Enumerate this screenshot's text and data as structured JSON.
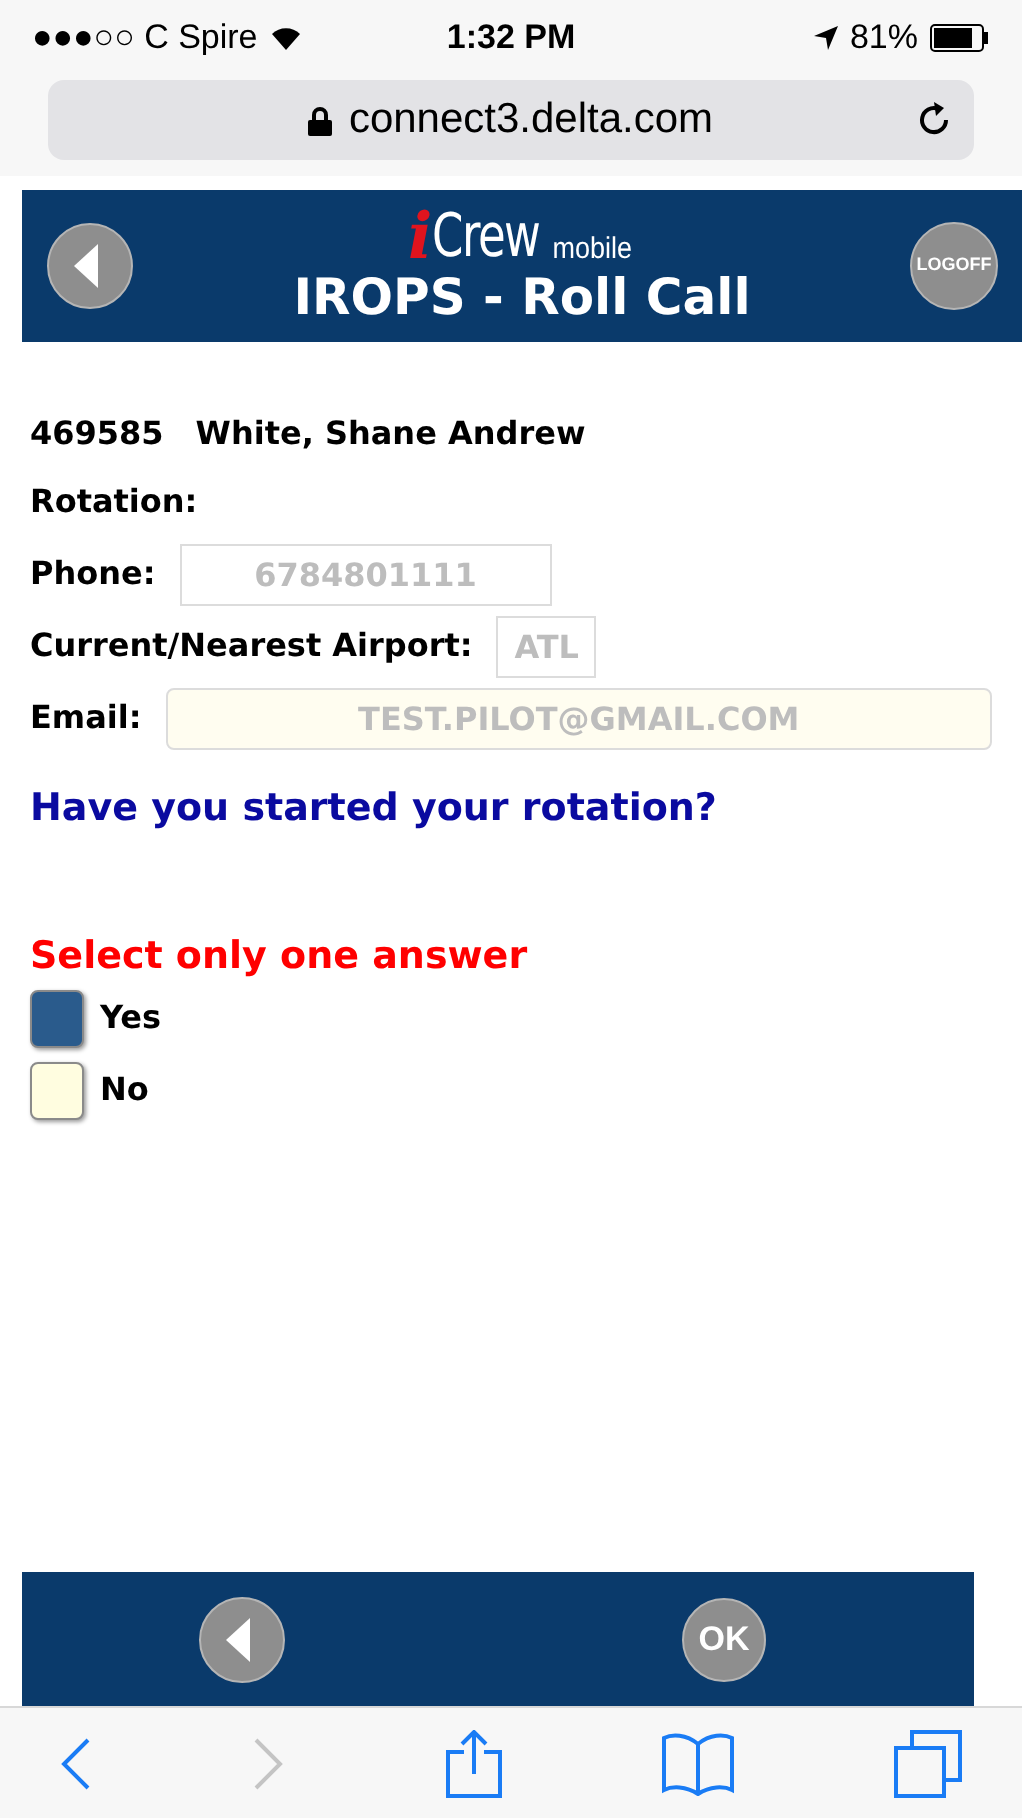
{
  "status_bar": {
    "carrier": "●●●○○ C Spire",
    "time": "1:32 PM",
    "battery": "81%"
  },
  "address_bar": {
    "url": "connect3.delta.com"
  },
  "header": {
    "logo": {
      "letter": "i",
      "word": "Crew",
      "suffix": "mobile"
    },
    "title": "IROPS - Roll Call",
    "logoff": "LOGOFF"
  },
  "crew": {
    "id": "469585",
    "name": "White, Shane Andrew"
  },
  "fields": [
    {
      "label": "Rotation:",
      "kind": "text"
    },
    {
      "label": "Phone:",
      "kind": "field",
      "value": "6784801111"
    },
    {
      "label": "Current/Nearest Airport:",
      "kind": "short",
      "value": "ATL"
    },
    {
      "label": "Email:",
      "kind": "wide",
      "value": "TEST.PILOT@GMAIL.COM"
    }
  ],
  "question": "Have you started your rotation?",
  "instruction": "Select only one answer",
  "answers": [
    {
      "label": "Yes",
      "selected": true
    },
    {
      "label": "No",
      "selected": false
    }
  ],
  "footer": {
    "ok": "OK"
  },
  "toolbar": {
    "back": {
      "disabled": false
    },
    "forward": {
      "disabled": true
    }
  }
}
